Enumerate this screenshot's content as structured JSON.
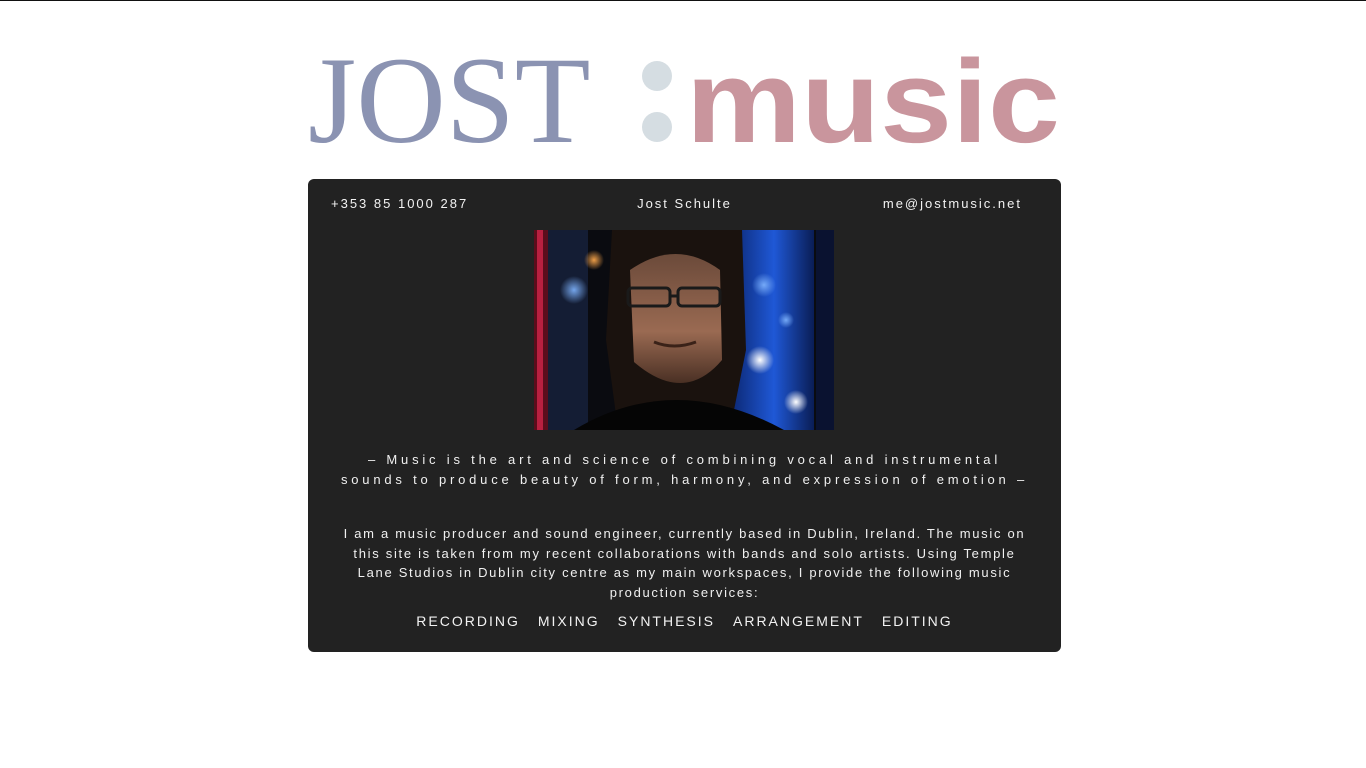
{
  "logo": {
    "part_one": "JOST",
    "part_two": "music",
    "colors": {
      "part_one": "#8b93b2",
      "colon": "#d5dde2",
      "part_two": "#c9959d"
    }
  },
  "contact": {
    "phone": "+353 85 1000 287",
    "name": "Jost Schulte",
    "email": "me@jostmusic.net"
  },
  "photo": {
    "alt": "portrait photo"
  },
  "quote": "– Music is the art and science of combining vocal and instrumental sounds to produce beauty of form, harmony, and expression of emotion –",
  "bio": "I am a music producer and sound engineer, currently based in Dublin, Ireland. The music on this site is taken from my recent collaborations with bands and solo artists. Using Temple Lane Studios in Dublin city centre as my main workspaces, I provide the following music production services:",
  "services": [
    {
      "label": "RECORDING"
    },
    {
      "label": "MIXING"
    },
    {
      "label": "SYNTHESIS"
    },
    {
      "label": "ARRANGEMENT"
    },
    {
      "label": "EDITING"
    }
  ],
  "theme": {
    "card_background": "#222222",
    "card_text": "#f0f0f0",
    "page_background": "#ffffff"
  }
}
